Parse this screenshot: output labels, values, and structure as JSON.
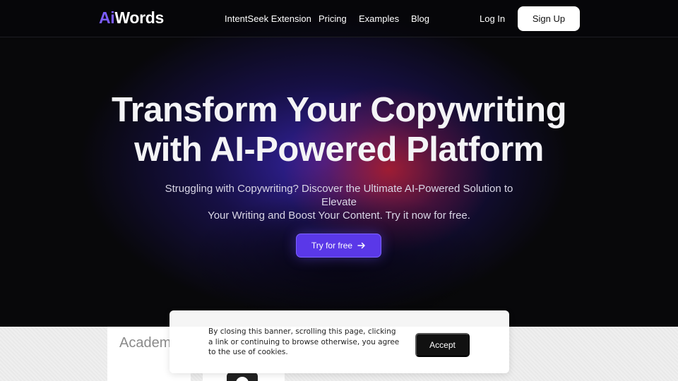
{
  "brand": {
    "logo_prefix": "Ai",
    "logo_suffix": "Words",
    "accent_color": "#7b5cff"
  },
  "nav": {
    "items": [
      {
        "label": "IntentSeek Extension"
      },
      {
        "label": "Pricing"
      },
      {
        "label": "Examples"
      },
      {
        "label": "Blog"
      }
    ],
    "login_label": "Log In",
    "signup_label": "Sign Up"
  },
  "hero": {
    "headline_line1": "Transform Your Copywriting",
    "headline_line2": "with AI-Powered Platform",
    "subtitle_line1": "Struggling with Copywriting? Discover the Ultimate AI-Powered Solution to Elevate",
    "subtitle_line2": "Your Writing and Boost Your Content. Try it now for free.",
    "cta_label": "Try for free",
    "cta_icon": "arrow-right-icon",
    "cta_color": "#5a38e8"
  },
  "lower": {
    "card_title": "Academ"
  },
  "cookie_banner": {
    "text": "By closing this banner, scrolling this page, clicking a link or continuing to browse otherwise, you agree to the use of cookies.",
    "accept_label": "Accept"
  }
}
